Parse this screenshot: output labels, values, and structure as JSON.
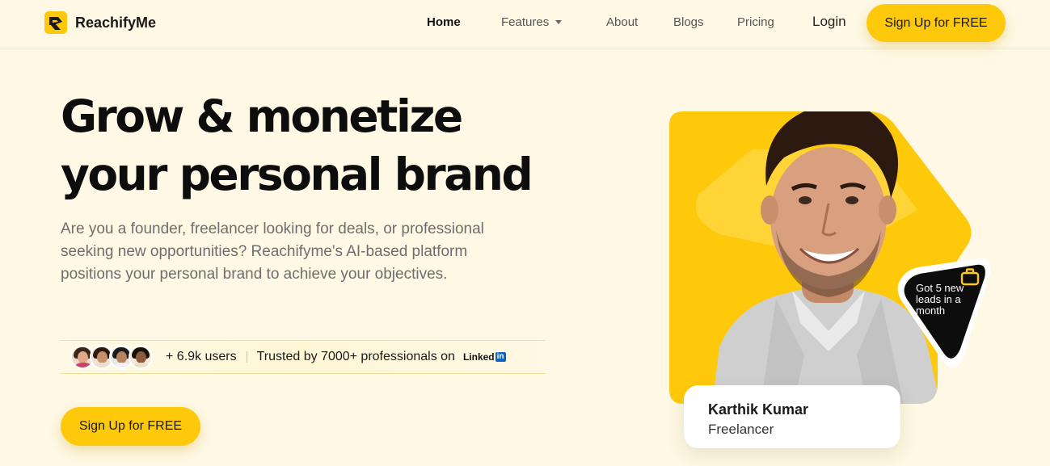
{
  "brand": {
    "name": "ReachifyMe",
    "logo_icon": "reachifyme-logo-icon",
    "accent_color": "#ffc90b"
  },
  "nav": {
    "items": [
      {
        "label": "Home",
        "active": true
      },
      {
        "label": "Features",
        "icon": "chevron-down-icon"
      },
      {
        "label": "About"
      },
      {
        "label": "Blogs"
      },
      {
        "label": "Pricing"
      }
    ],
    "login_label": "Login",
    "signup_label": "Sign Up for FREE"
  },
  "hero": {
    "title_line1": "Grow & monetize",
    "title_line2": "your personal brand",
    "description": "Are you a founder, freelancer looking for deals, or professional seeking new opportunities? Reachifyme's AI-based platform positions your personal brand to achieve your objectives.",
    "users_count": "+ 6.9k users",
    "trusted_text": "Trusted by 7000+ professionals on",
    "linkedin_text": "Linked",
    "linkedin_in": "in",
    "cta_label": "Sign Up for FREE"
  },
  "testimonial": {
    "name": "Karthik Kumar",
    "role": "Freelancer",
    "badge_text": "Got 5 new leads in a month",
    "badge_icon": "briefcase-icon"
  }
}
